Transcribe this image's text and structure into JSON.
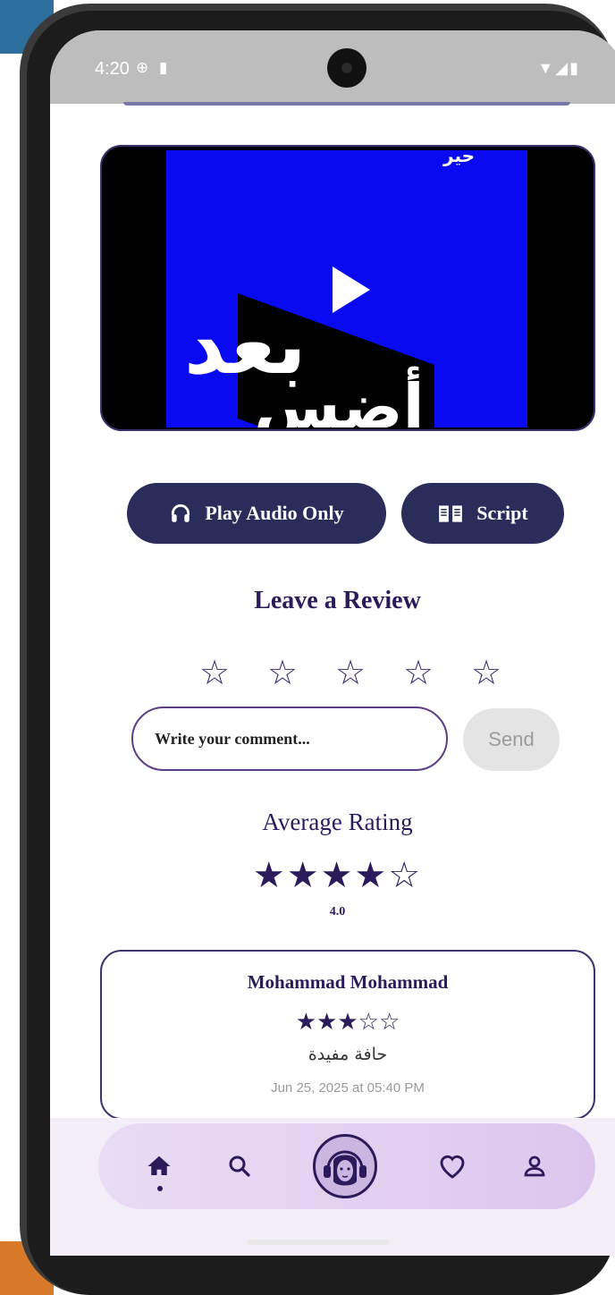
{
  "status_bar": {
    "time": "4:20",
    "left_icons": [
      "vpn-icon",
      "sdcard-icon"
    ],
    "right_icons": [
      "wifi-icon",
      "signal-icon",
      "battery-icon"
    ]
  },
  "video": {
    "arabic_text_line1": "بعد",
    "arabic_text_line2": "أضس",
    "arabic_text_top": "حير",
    "play_icon": "play-icon"
  },
  "actions": {
    "audio_label": "Play Audio Only",
    "audio_icon": "headphones-icon",
    "script_label": "Script",
    "script_icon": "book-icon"
  },
  "review_form": {
    "title": "Leave a Review",
    "stars": [
      "☆",
      "☆",
      "☆",
      "☆",
      "☆"
    ],
    "comment_placeholder": "Write your comment...",
    "send_label": "Send"
  },
  "average": {
    "title": "Average Rating",
    "stars": "★★★★☆",
    "value": "4.0"
  },
  "reviews": [
    {
      "name": "Mohammad Mohammad",
      "stars": "★★★☆☆",
      "comment": "حافة مفيدة",
      "date": "Jun 25, 2025 at 05:40 PM"
    }
  ],
  "nav": {
    "items": [
      "home-icon",
      "search-icon",
      "avatar",
      "heart-icon",
      "profile-icon"
    ],
    "active": "home-icon"
  },
  "colors": {
    "primary": "#2a2c5a",
    "text_dark": "#2b1b5a",
    "video_blue": "#0a0af2",
    "nav_bg": "#e4d2f1"
  }
}
